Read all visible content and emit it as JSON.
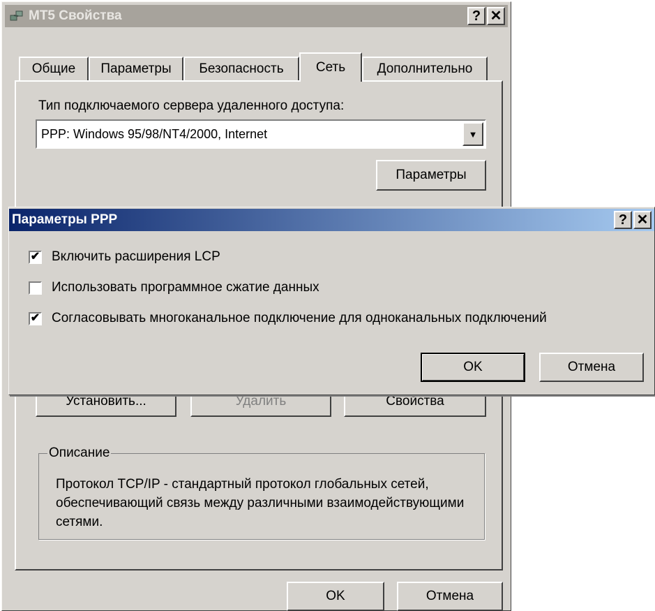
{
  "main_window": {
    "title": "МТ5 Свойства",
    "help_label": "?",
    "close_label": "✕",
    "tabs": [
      {
        "label": "Общие"
      },
      {
        "label": "Параметры"
      },
      {
        "label": "Безопасность"
      },
      {
        "label": "Сеть"
      },
      {
        "label": "Дополнительно"
      }
    ],
    "server_type_label": "Тип подключаемого сервера удаленного доступа:",
    "server_type_value": "PPP: Windows 95/98/NT4/2000, Internet",
    "settings_button": "Параметры",
    "component_buttons": [
      "Установить...",
      "Удалить",
      "Свойства"
    ],
    "description_title": "Описание",
    "description_text": "Протокол TCP/IP - стандартный протокол глобальных сетей, обеспечивающий связь между различными взаимодействующими сетями.",
    "ok_button": "OK",
    "cancel_button": "Отмена"
  },
  "ppp_dialog": {
    "title": "Параметры PPP",
    "help_label": "?",
    "close_label": "✕",
    "options": [
      {
        "label": "Включить расширения LCP",
        "checked": true
      },
      {
        "label": "Использовать программное сжатие данных",
        "checked": false
      },
      {
        "label": "Согласовывать многоканальное подключение для одноканальных подключений",
        "checked": true
      }
    ],
    "ok_button": "OK",
    "cancel_button": "Отмена"
  },
  "icons": {
    "window_icon": "network-connection-icon",
    "dropdown_icon": "chevron-down-icon",
    "check_glyph": "✔"
  },
  "colors": {
    "face": "#d6d3ce",
    "dialog_title_start": "#0a246a",
    "dialog_title_end": "#a6caf0",
    "inactive_title": "#a7a39c"
  }
}
